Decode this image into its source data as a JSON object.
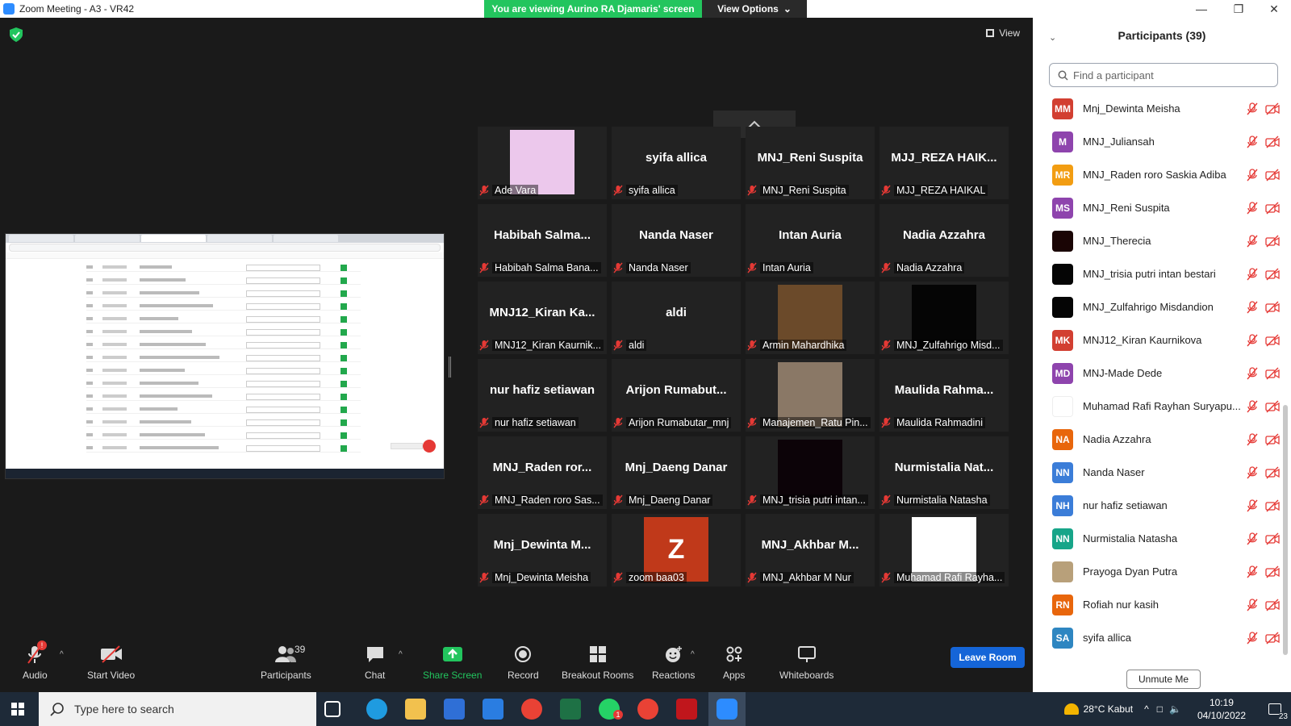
{
  "window": {
    "title": "Zoom Meeting - A3 - VR42"
  },
  "share_banner": {
    "text": "You are viewing Aurino RA Djamaris' screen",
    "view_options": "View Options"
  },
  "meeting": {
    "view_label": "View"
  },
  "tiles": [
    {
      "big": "",
      "label": "Ade Vara",
      "pic": "#ecc8ec"
    },
    {
      "big": "syifa allica",
      "label": "syifa allica"
    },
    {
      "big": "MNJ_Reni Suspita",
      "label": "MNJ_Reni Suspita"
    },
    {
      "big": "MJJ_REZA HAIK...",
      "label": "MJJ_REZA HAIKAL"
    },
    {
      "big": "Habibah Salma...",
      "label": "Habibah Salma Bana..."
    },
    {
      "big": "Nanda Naser",
      "label": "Nanda Naser"
    },
    {
      "big": "Intan Auria",
      "label": "Intan Auria"
    },
    {
      "big": "Nadia Azzahra",
      "label": "Nadia Azzahra"
    },
    {
      "big": "MNJ12_Kiran Ka...",
      "label": "MNJ12_Kiran Kaurnik..."
    },
    {
      "big": "aldi",
      "label": "aldi"
    },
    {
      "big": "",
      "label": "Armin Mahardhika",
      "pic": "#6b4a2a"
    },
    {
      "big": "",
      "label": "MNJ_Zulfahrigo Misd...",
      "pic": "#050505"
    },
    {
      "big": "nur hafiz setiawan",
      "label": "nur hafiz setiawan"
    },
    {
      "big": "Arijon Rumabut...",
      "label": "Arijon Rumabutar_mnj"
    },
    {
      "big": "",
      "label": "Manajemen_Ratu Pin...",
      "pic": "#8a7866"
    },
    {
      "big": "Maulida Rahma...",
      "label": "Maulida Rahmadini"
    },
    {
      "big": "MNJ_Raden ror...",
      "label": "MNJ_Raden roro Sas..."
    },
    {
      "big": "Mnj_Daeng Danar",
      "label": "Mnj_Daeng Danar"
    },
    {
      "big": "",
      "label": "MNJ_trisia putri intan...",
      "pic": "#0c0308"
    },
    {
      "big": "Nurmistalia Nat...",
      "label": "Nurmistalia Natasha"
    },
    {
      "big": "Mnj_Dewinta M...",
      "label": "Mnj_Dewinta Meisha"
    },
    {
      "big": "",
      "label": "zoom baa03",
      "pic": "#c0391a",
      "letter": "Z"
    },
    {
      "big": "MNJ_Akhbar M...",
      "label": "MNJ_Akhbar M Nur"
    },
    {
      "big": "",
      "label": "Muhamad Rafi Rayha...",
      "pic": "#ffffff"
    }
  ],
  "toolbar": {
    "audio": "Audio",
    "audio_badge": "!",
    "video": "Start Video",
    "participants": "Participants",
    "participants_count": "39",
    "chat": "Chat",
    "share": "Share Screen",
    "record": "Record",
    "breakout": "Breakout Rooms",
    "reactions": "Reactions",
    "apps": "Apps",
    "whiteboards": "Whiteboards",
    "leave": "Leave Room"
  },
  "panel": {
    "title": "Participants (39)",
    "search_placeholder": "Find a participant",
    "unmute": "Unmute Me",
    "participants": [
      {
        "initials": "MM",
        "color": "#d23f31",
        "name": "Mnj_Dewinta Meisha"
      },
      {
        "initials": "M",
        "color": "#8e44ad",
        "name": "MNJ_Juliansah"
      },
      {
        "initials": "MR",
        "color": "#f29d12",
        "name": "MNJ_Raden roro Saskia Adiba"
      },
      {
        "initials": "MS",
        "color": "#8e44ad",
        "name": "MNJ_Reni Suspita"
      },
      {
        "initials": "",
        "color": "#1a0505",
        "name": "MNJ_Therecia"
      },
      {
        "initials": "",
        "color": "#050505",
        "name": "MNJ_trisia putri intan bestari"
      },
      {
        "initials": "",
        "color": "#050505",
        "name": "MNJ_Zulfahrigo Misdandion"
      },
      {
        "initials": "MK",
        "color": "#d23f31",
        "name": "MNJ12_Kiran Kaurnikova"
      },
      {
        "initials": "MD",
        "color": "#8e44ad",
        "name": "MNJ-Made Dede"
      },
      {
        "initials": "",
        "color": "#ffffff",
        "name": "Muhamad Rafi Rayhan Suryapu..."
      },
      {
        "initials": "NA",
        "color": "#e8660c",
        "name": "Nadia Azzahra"
      },
      {
        "initials": "NN",
        "color": "#3b7dd8",
        "name": "Nanda Naser"
      },
      {
        "initials": "NH",
        "color": "#3b7dd8",
        "name": "nur hafiz setiawan"
      },
      {
        "initials": "NN",
        "color": "#17a589",
        "name": "Nurmistalia Natasha"
      },
      {
        "initials": "",
        "color": "#b8a07a",
        "name": "Prayoga Dyan Putra"
      },
      {
        "initials": "RN",
        "color": "#e8660c",
        "name": "Rofiah nur kasih"
      },
      {
        "initials": "SA",
        "color": "#2e86c1",
        "name": "syifa allica"
      }
    ]
  },
  "taskbar": {
    "search_placeholder": "Type here to search",
    "weather": "28°C  Kabut",
    "time": "10:19",
    "date": "04/10/2022",
    "notif_count": "23",
    "whatsapp_badge": "1"
  },
  "colors": {
    "share_green": "#23c55e",
    "leave_blue": "#1565d8",
    "mute_red": "#e53935"
  }
}
